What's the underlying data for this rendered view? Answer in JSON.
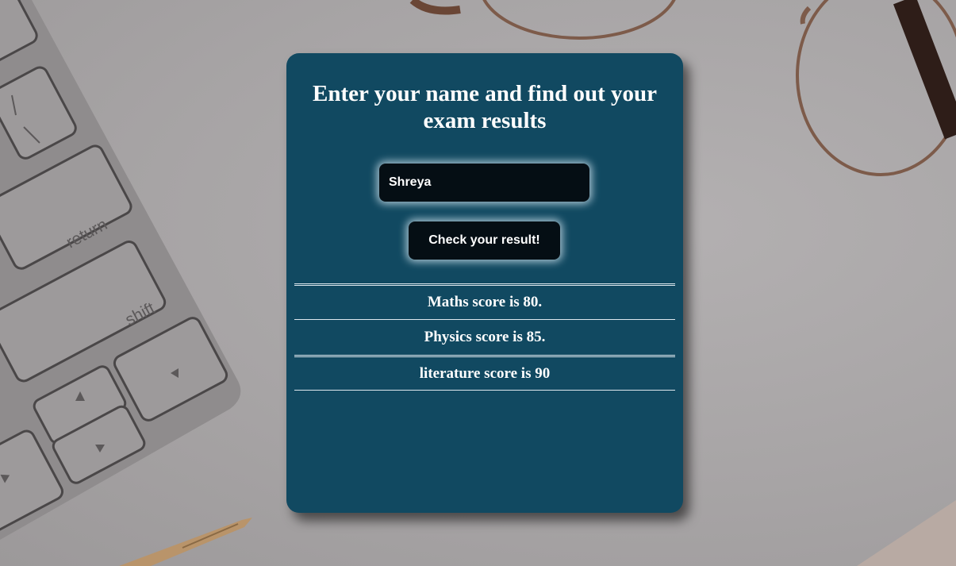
{
  "page": {
    "heading": "Enter your name and find out your exam results"
  },
  "form": {
    "name_value": "Shreya",
    "check_button_label": "Check your result!"
  },
  "results": [
    {
      "label": "Maths score is 80."
    },
    {
      "label": "Physics score is 85."
    },
    {
      "label": "literature score is 90"
    }
  ],
  "background": {
    "keyboard_keys": [
      "return",
      "shift"
    ]
  },
  "colors": {
    "card": "#114961",
    "control_bg": "#050e14",
    "text": "#ffffff"
  }
}
